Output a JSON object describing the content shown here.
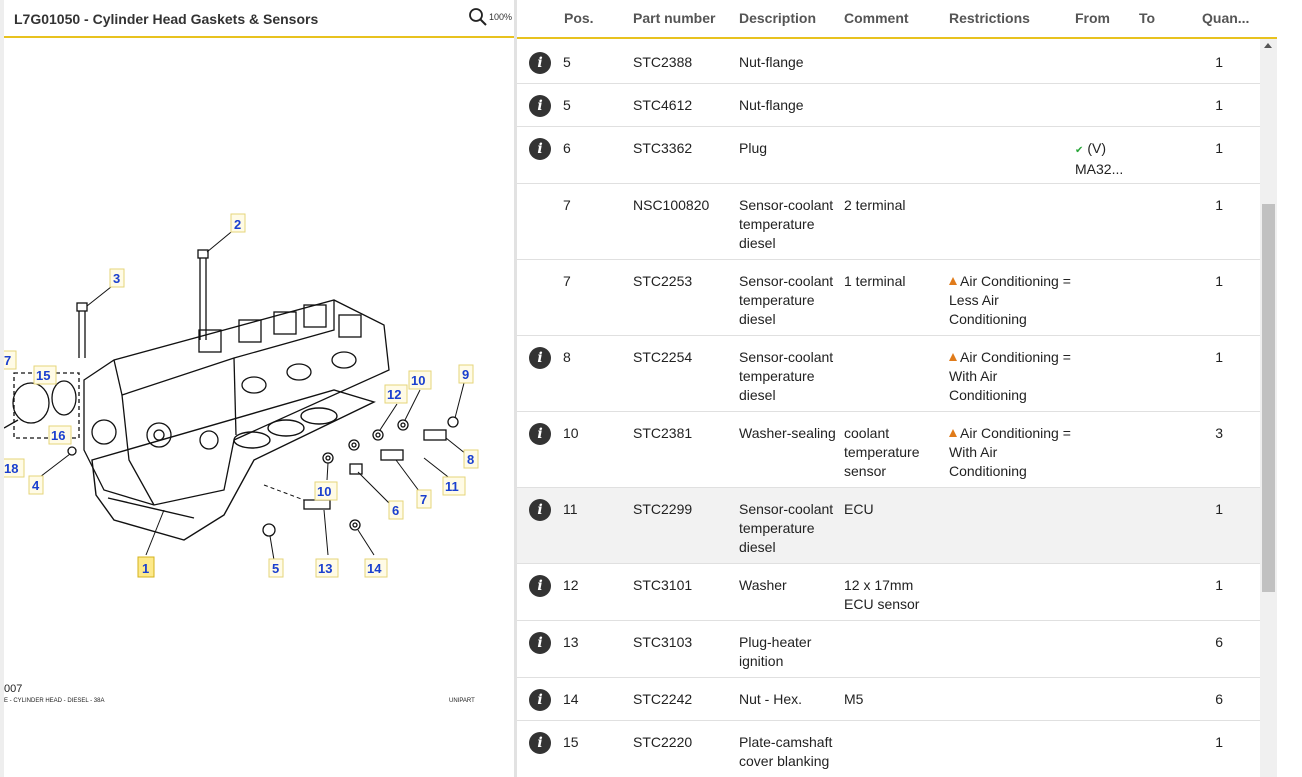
{
  "diagram": {
    "title": "L7G01050 - Cylinder Head Gaskets & Sensors",
    "zoom_level": "100%",
    "callouts": [
      "1",
      "2",
      "3",
      "4",
      "5",
      "6",
      "7",
      "7",
      "8",
      "9",
      "10",
      "10",
      "11",
      "12",
      "13",
      "14",
      "15",
      "16",
      "18"
    ],
    "plate_number": "007",
    "plate_caption": "E - CYLINDER HEAD - DIESEL - 38A",
    "plate_brand": "UNIPART"
  },
  "table": {
    "columns": [
      "Pos.",
      "Part number",
      "Description",
      "Comment",
      "Restrictions",
      "From",
      "To",
      "Quan..."
    ],
    "rows": [
      {
        "info": true,
        "pos": "5",
        "part": "STC2388",
        "desc": "Nut-flange",
        "comment": "",
        "restriction": "",
        "from": "",
        "qty": "1"
      },
      {
        "info": true,
        "pos": "5",
        "part": "STC4612",
        "desc": "Nut-flange",
        "comment": "",
        "restriction": "",
        "from": "",
        "qty": "1"
      },
      {
        "info": true,
        "pos": "6",
        "part": "STC3362",
        "desc": "Plug",
        "comment": "",
        "restriction": "",
        "from": "(V) MA32...",
        "qty": "1"
      },
      {
        "info": false,
        "pos": "7",
        "part": "NSC100820",
        "desc": "Sensor-coolant temperature diesel",
        "comment": "2 terminal",
        "restriction": "",
        "from": "",
        "qty": "1"
      },
      {
        "info": false,
        "pos": "7",
        "part": "STC2253",
        "desc": "Sensor-coolant temperature diesel",
        "comment": "1 terminal",
        "restriction": "Air Conditioning = Less Air Conditioning",
        "from": "",
        "qty": "1"
      },
      {
        "info": true,
        "pos": "8",
        "part": "STC2254",
        "desc": "Sensor-coolant temperature diesel",
        "comment": "",
        "restriction": "Air Conditioning = With Air Conditioning",
        "from": "",
        "qty": "1"
      },
      {
        "info": true,
        "pos": "10",
        "part": "STC2381",
        "desc": "Washer-sealing",
        "comment": "coolant temperature sensor",
        "restriction": "Air Conditioning = With Air Conditioning",
        "from": "",
        "qty": "3"
      },
      {
        "info": true,
        "pos": "11",
        "part": "STC2299",
        "desc": "Sensor-coolant temperature diesel",
        "comment": "ECU",
        "restriction": "",
        "from": "",
        "qty": "1"
      },
      {
        "info": true,
        "pos": "12",
        "part": "STC3101",
        "desc": "Washer",
        "comment": "12 x 17mm ECU sensor",
        "restriction": "",
        "from": "",
        "qty": "1"
      },
      {
        "info": true,
        "pos": "13",
        "part": "STC3103",
        "desc": "Plug-heater ignition",
        "comment": "",
        "restriction": "",
        "from": "",
        "qty": "6"
      },
      {
        "info": true,
        "pos": "14",
        "part": "STC2242",
        "desc": "Nut - Hex.",
        "comment": "M5",
        "restriction": "",
        "from": "",
        "qty": "6"
      },
      {
        "info": true,
        "pos": "15",
        "part": "STC2220",
        "desc": "Plate-camshaft cover blanking",
        "comment": "",
        "restriction": "",
        "from": "",
        "qty": "1"
      }
    ],
    "highlighted_row": 7,
    "info_icon": "info-circle-icon",
    "warning_icon": "warning-triangle-icon",
    "check_icon": "check-icon",
    "colors": {
      "accent": "#e8c21f",
      "callout": "#1a3fcf",
      "warning": "#e07b1a",
      "check": "#2aa63a",
      "row_highlight": "#f2f2f2"
    }
  }
}
